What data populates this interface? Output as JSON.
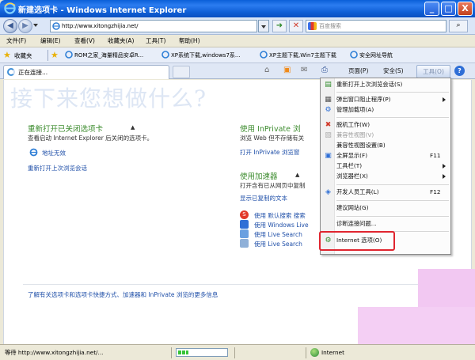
{
  "window": {
    "title": "新建选项卡 - Windows Internet Explorer",
    "minimize": "_",
    "maximize": "□",
    "close": "X"
  },
  "address": {
    "url": "http://www.xitongzhijia.net/",
    "search_placeholder": "百度搜索",
    "go": "➜",
    "stop": "✕",
    "search_go": "⌕"
  },
  "menu": [
    "文件(F)",
    "编辑(E)",
    "查看(V)",
    "收藏夹(A)",
    "工具(T)",
    "帮助(H)"
  ],
  "favorites": {
    "label": "收藏夹",
    "links": [
      "ROM之家_海量精品安卓R...",
      "XP系统下载,windows7系...",
      "XP主题下载,Win7主题下载",
      "安全网址导航"
    ]
  },
  "tab": {
    "label": "正在连接..."
  },
  "commands": {
    "page": "页面(P)",
    "safety": "安全(S)",
    "tools": "工具(O)",
    "help": "?"
  },
  "content": {
    "heading": "接下来您想做什么?",
    "reopen": {
      "title": "重新打开已关闭选项卡",
      "desc": "查看启动 Internet Explorer 后关闭的选项卡。",
      "item": "地址无效",
      "link": "重新打开上次浏览会话"
    },
    "inprivate": {
      "title": "使用 InPrivate 浏",
      "desc": "浏览 Web 但不存储有关",
      "link": "打开 InPrivate 浏览窗"
    },
    "accelerators": {
      "title": "使用加速器",
      "desc": "打开含有已从网页中复制",
      "show": "显示已复制的文本",
      "items": [
        "使用 默认搜索 搜索",
        "使用 Windows Live",
        "使用 Live Search",
        "使用 Live Search"
      ]
    },
    "footer": "了解有关选项卡和选项卡快捷方式、加速器和 InPrivate 浏览的更多信息"
  },
  "tools_menu": {
    "items": [
      {
        "label": "重新打开上次浏览会话(S)",
        "shortcut": "",
        "submenu": false,
        "disabled": false,
        "icon": "reopen-icon"
      },
      {
        "label": "弹出窗口阻止程序(P)",
        "shortcut": "",
        "submenu": true,
        "disabled": false,
        "icon": "popup-blocker-icon"
      },
      {
        "label": "管理加载项(A)",
        "shortcut": "",
        "submenu": false,
        "disabled": false,
        "icon": "addons-icon"
      },
      {
        "label": "脱机工作(W)",
        "shortcut": "",
        "submenu": false,
        "disabled": false,
        "icon": "offline-icon"
      },
      {
        "label": "兼容性视图(V)",
        "shortcut": "",
        "submenu": false,
        "disabled": true,
        "icon": "compat-view-icon"
      },
      {
        "label": "兼容性视图设置(B)",
        "shortcut": "",
        "submenu": false,
        "disabled": false,
        "icon": ""
      },
      {
        "label": "全屏显示(F)",
        "shortcut": "F11",
        "submenu": false,
        "disabled": false,
        "icon": "fullscreen-icon"
      },
      {
        "label": "工具栏(T)",
        "shortcut": "",
        "submenu": true,
        "disabled": false,
        "icon": ""
      },
      {
        "label": "浏览器栏(X)",
        "shortcut": "",
        "submenu": true,
        "disabled": false,
        "icon": ""
      },
      {
        "label": "开发人员工具(L)",
        "shortcut": "F12",
        "submenu": false,
        "disabled": false,
        "icon": "dev-tools-icon"
      },
      {
        "label": "建议网站(G)",
        "shortcut": "",
        "submenu": false,
        "disabled": false,
        "icon": ""
      },
      {
        "label": "诊断连接问题...",
        "shortcut": "",
        "submenu": false,
        "disabled": false,
        "icon": ""
      },
      {
        "label": "Internet 选项(O)",
        "shortcut": "",
        "submenu": false,
        "disabled": false,
        "icon": "internet-options-icon"
      }
    ]
  },
  "status": {
    "text": "等待 http://www.xitongzhijia.net/...",
    "progress_fraction": 0.22,
    "zone": "Internet"
  },
  "colors": {
    "title_bar": "#0a5fd8",
    "section_title": "#3d8c2f",
    "link": "#1f4fa8",
    "highlight_box": "#e0252f"
  }
}
